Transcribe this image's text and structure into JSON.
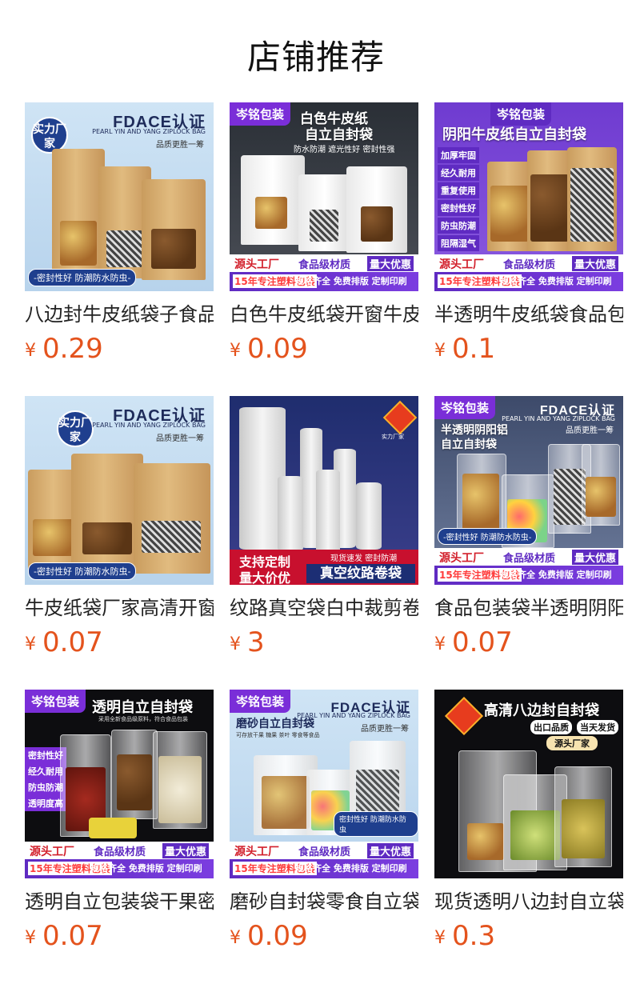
{
  "page": {
    "title": "店铺推荐"
  },
  "currency_symbol": "¥",
  "products": [
    {
      "name": "八边封牛皮纸袋子食品包装",
      "price": "0.29",
      "image": {
        "brand": "FDACE认证",
        "brand_sub": "PEARL YIN AND YANG ZIPLOCK BAG",
        "tagline": "品质更胜一筹",
        "badge": "实力厂家",
        "bottom_label": "-密封性好 防潮防水防虫-"
      }
    },
    {
      "name": "白色牛皮纸袋开窗牛皮纸",
      "price": "0.09",
      "image": {
        "corner_tag": "岑铭包装",
        "headline_1": "白色牛皮纸",
        "headline_2": "自立自封袋",
        "features": "防水防潮  遮光性好  密封性强",
        "strip": [
          "源头工厂",
          "食品级材质",
          "量大优惠",
          "15年专注塑料包装",
          "规格齐全 免费排版 定制印刷"
        ]
      }
    },
    {
      "name": "半透明牛皮纸袋食品包装",
      "price": "0.1",
      "image": {
        "corner_tag": "岑铭包装",
        "headline": "阴阳牛皮纸自立自封袋",
        "features": [
          "加厚牢固",
          "经久耐用",
          "重复使用",
          "密封性好",
          "防虫防潮",
          "阻隔湿气"
        ],
        "strip": [
          "源头工厂",
          "食品级材质",
          "量大优惠",
          "15年专注塑料包装",
          "规格齐全 免费排版 定制印刷"
        ]
      }
    },
    {
      "name": "牛皮纸袋厂家高清开窗",
      "price": "0.07",
      "image": {
        "brand": "FDACE认证",
        "brand_sub": "PEARL YIN AND YANG ZIPLOCK BAG",
        "tagline": "品质更胜一筹",
        "badge": "实力厂家",
        "bottom_label": "-密封性好 防潮防水防虫-"
      }
    },
    {
      "name": "纹路真空袋白中裁剪卷袋",
      "price": "3",
      "image": {
        "logo_text": "实力厂家",
        "left_1": "支持定制",
        "left_2": "量大价优",
        "right_small": "现货速发 密封防潮",
        "right_big": "真空纹路卷袋"
      }
    },
    {
      "name": "食品包装袋半透明阴阳铝",
      "price": "0.07",
      "image": {
        "corner_tag": "岑铭包装",
        "brand": "FDACE认证",
        "brand_sub": "PEARL YIN AND YANG ZIPLOCK BAG",
        "tagline": "品质更胜一筹",
        "headline_1": "半透明阴阳铝",
        "headline_2": "自立自封袋",
        "bottom_label": "-密封性好 防潮防水防虫-",
        "strip": [
          "源头工厂",
          "食品级材质",
          "量大优惠",
          "15年专注塑料包装",
          "规格齐全 免费排版 定制印刷"
        ]
      }
    },
    {
      "name": "透明自立包装袋干果密封",
      "price": "0.07",
      "image": {
        "corner_tag": "岑铭包装",
        "headline": "透明自立自封袋",
        "sub": "采用全新食品级原料，符合食品包装",
        "features": [
          "密封性好",
          "经久耐用",
          "防虫防潮",
          "透明度高"
        ],
        "strip": [
          "源头工厂",
          "食品级材质",
          "量大优惠",
          "15年专注塑料包装",
          "规格齐全 免费排版 定制印刷"
        ]
      }
    },
    {
      "name": "磨砂自封袋零食自立袋",
      "price": "0.09",
      "image": {
        "corner_tag": "岑铭包装",
        "brand": "FDACE认证",
        "brand_sub": "PEARL YIN AND YANG ZIPLOCK BAG",
        "tagline": "品质更胜一筹",
        "headline": "磨砂自立自封袋",
        "sub": "可存放干果 糖果 茶叶 零食等食品",
        "bottom_label": "密封性好 防潮防水防虫",
        "strip": [
          "源头工厂",
          "食品级材质",
          "量大优惠",
          "15年专注塑料包装",
          "规格齐全 免费排版 定制印刷"
        ]
      }
    },
    {
      "name": "现货透明八边封自立袋",
      "price": "0.3",
      "image": {
        "headline": "高清八边封自封袋",
        "pill_1": "出口品质",
        "pill_2": "当天发货",
        "pill_3": "源头厂家"
      }
    }
  ]
}
